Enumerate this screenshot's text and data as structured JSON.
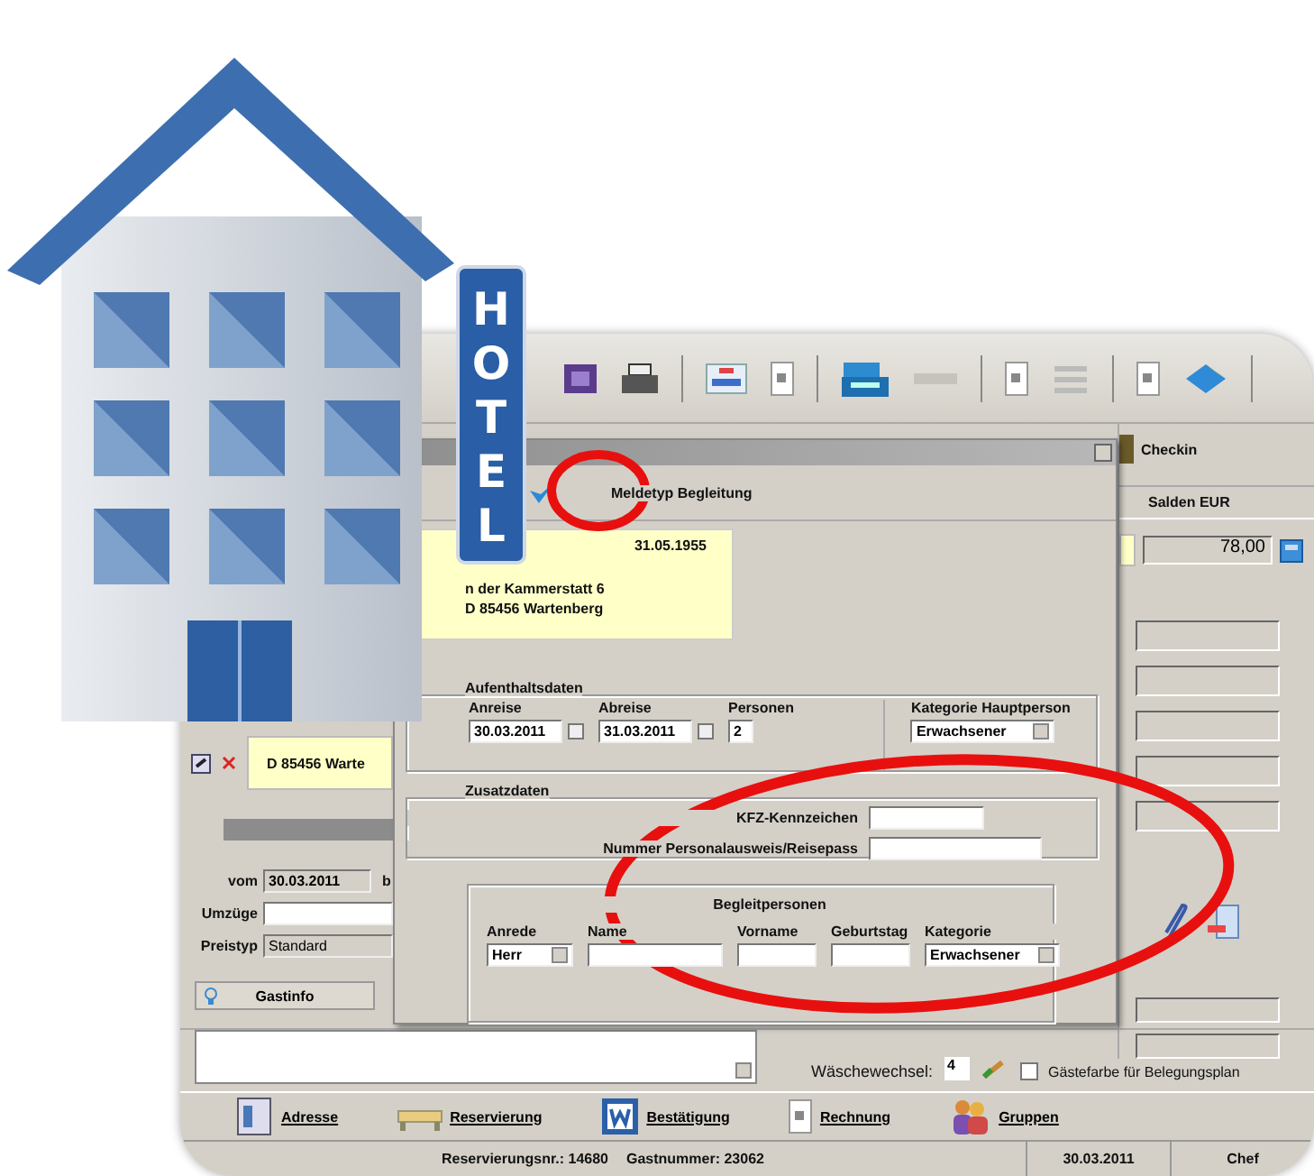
{
  "sign": {
    "text": "HOTEL"
  },
  "left_panel": {
    "address_card": "D 85456 Warte",
    "from_label": "vom",
    "from_value": "30.03.2011",
    "to_label": "b",
    "moves_label": "Umzüge",
    "price_type_label": "Preistyp",
    "price_type_value": "Standard",
    "tab": "Gastinfo"
  },
  "right_panel": {
    "checkin": "Checkin",
    "balance_header": "Salden EUR",
    "balance_value": "78,00"
  },
  "linen": {
    "label": "Wäschewechsel:",
    "value": "4",
    "guest_color_label": "Gästefarbe für Belegungsplan",
    "guest_color_checked": false
  },
  "dialog": {
    "heading": "Meldetyp Begleitung",
    "card": {
      "date": "31.05.1955",
      "lines": [
        "n der Kammerstatt 6",
        "D 85456 Wartenberg"
      ]
    },
    "stay": {
      "title": "Aufenthaltsdaten",
      "fields": [
        {
          "label": "Anreise",
          "value": "30.03.2011",
          "kind": "date"
        },
        {
          "label": "Abreise",
          "value": "31.03.2011",
          "kind": "date"
        },
        {
          "label": "Personen",
          "value": "2",
          "kind": "number"
        }
      ],
      "category": {
        "label": "Kategorie Hauptperson",
        "value": "Erwachsener"
      }
    },
    "extra": {
      "title": "Zusatzdaten",
      "fields": [
        {
          "label": "KFZ-Kennzeichen"
        },
        {
          "label": "Nummer Personalausweis/Reisepass"
        }
      ]
    },
    "companions": {
      "title": "Begleitpersonen",
      "columns": [
        {
          "label": "Anrede",
          "kind": "select",
          "value": "Herr"
        },
        {
          "label": "Name",
          "kind": "text"
        },
        {
          "label": "Vorname",
          "kind": "text"
        },
        {
          "label": "Geburtstag",
          "kind": "text"
        },
        {
          "label": "Kategorie",
          "kind": "select",
          "value": "Erwachsener"
        }
      ]
    }
  },
  "actions": [
    {
      "label": "Adresse"
    },
    {
      "label": "Reservierung"
    },
    {
      "label": "Bestätigung"
    },
    {
      "label": "Rechnung"
    },
    {
      "label": "Gruppen"
    }
  ],
  "status_bar": {
    "reservation": "Reservierungsnr.: 14680",
    "guest_number": "Gastnummer: 23062",
    "date": "30.03.2011",
    "user": "Chef"
  }
}
